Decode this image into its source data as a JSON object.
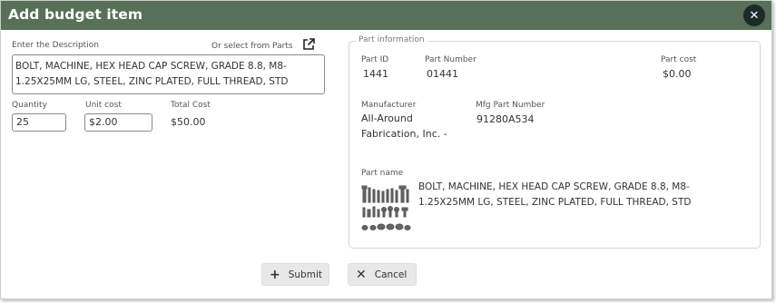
{
  "dialog": {
    "title": "Add budget item"
  },
  "form": {
    "description_label": "Enter the Description",
    "select_parts_label": "Or select from Parts",
    "description_value": "BOLT, MACHINE, HEX HEAD CAP SCREW, GRADE 8.8, M8-1.25X25MM LG, STEEL,  ZINC PLATED, FULL THREAD, STD",
    "quantity_label": "Quantity",
    "quantity_value": "25",
    "unit_cost_label": "Unit cost",
    "unit_cost_value": "$2.00",
    "total_cost_label": "Total Cost",
    "total_cost_value": "$50.00"
  },
  "part_info": {
    "legend": "Part information",
    "part_id_label": "Part ID",
    "part_id_value": "1441",
    "part_number_label": "Part Number",
    "part_number_value": "01441",
    "part_cost_label": "Part cost",
    "part_cost_value": "$0.00",
    "manufacturer_label": "Manufacturer",
    "manufacturer_value": "All-Around Fabrication, Inc. -",
    "mfg_part_number_label": "Mfg Part Number",
    "mfg_part_number_value": "91280A534",
    "part_name_label": "Part name",
    "part_name_value": "BOLT, MACHINE, HEX HEAD CAP SCREW, GRADE 8.8, M8-1.25X25MM LG, STEEL,  ZINC PLATED, FULL THREAD, STD"
  },
  "actions": {
    "submit_label": "Submit",
    "cancel_label": "Cancel"
  },
  "icons": {
    "close": "close-icon",
    "external_link": "external-link-icon",
    "submit": "plus-icon",
    "cancel": "x-icon",
    "part_image": "bolt-assortment-thumbnail"
  },
  "colors": {
    "header_bg": "#587058",
    "close_bg": "#1e2a2a",
    "button_bg": "#e8e8e8"
  }
}
